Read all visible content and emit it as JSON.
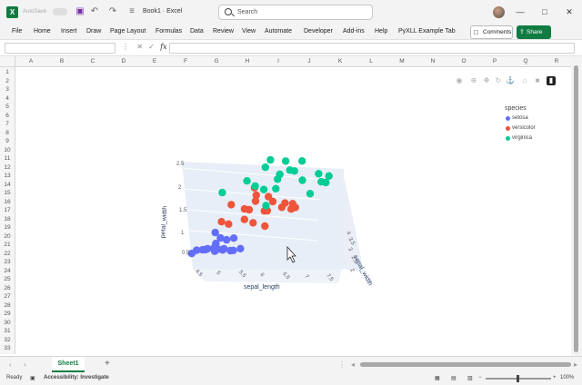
{
  "titlebar": {
    "autosave_label": "AutoSave",
    "doc_title": "Book1 · Excel",
    "search_placeholder": "Search"
  },
  "menu": [
    "File",
    "Home",
    "Insert",
    "Draw",
    "Page Layout",
    "Formulas",
    "Data",
    "Review",
    "View",
    "Automate",
    "Developer",
    "Add-ins",
    "Help",
    "PyXLL Example Tab"
  ],
  "comments_label": "Comments",
  "share_label": "Share",
  "formula_bar": {
    "fx_label": "fx"
  },
  "columns": [
    "A",
    "B",
    "C",
    "D",
    "E",
    "F",
    "G",
    "H",
    "I",
    "J",
    "K",
    "L",
    "M",
    "N",
    "O",
    "P",
    "Q",
    "R"
  ],
  "rows": [
    "1",
    "2",
    "3",
    "4",
    "5",
    "6",
    "7",
    "8",
    "9",
    "10",
    "11",
    "12",
    "13",
    "14",
    "15",
    "16",
    "17",
    "18",
    "19",
    "20",
    "21",
    "22",
    "23",
    "24",
    "25",
    "26",
    "27",
    "28",
    "29",
    "30",
    "31",
    "32",
    "33"
  ],
  "chart_data": {
    "type": "scatter",
    "dimensions": 3,
    "x_label": "sepal_length",
    "y_label": "sepal_width",
    "z_label": "petal_width",
    "x_ticks": [
      "4.5",
      "5",
      "5.5",
      "6",
      "6.5",
      "7",
      "7.5"
    ],
    "y_ticks": [
      "2",
      "2.5",
      "3",
      "3.5",
      "4"
    ],
    "z_ticks": [
      "0.5",
      "1",
      "1.5",
      "2",
      "2.5"
    ],
    "legend": {
      "title": "species",
      "position": "top-right",
      "items": [
        {
          "name": "setosa",
          "color": "#636efa"
        },
        {
          "name": "versicolor",
          "color": "#ef553b"
        },
        {
          "name": "virginica",
          "color": "#00cc96"
        }
      ]
    },
    "series": [
      {
        "name": "setosa",
        "points": [
          [
            4.3,
            3.0,
            0.1
          ],
          [
            4.4,
            2.9,
            0.2
          ],
          [
            4.6,
            3.1,
            0.2
          ],
          [
            4.7,
            3.2,
            0.2
          ],
          [
            4.8,
            3.4,
            0.2
          ],
          [
            4.9,
            3.0,
            0.2
          ],
          [
            5.0,
            3.6,
            0.2
          ],
          [
            5.0,
            3.4,
            0.2
          ],
          [
            5.1,
            3.5,
            0.2
          ],
          [
            5.1,
            3.8,
            0.3
          ],
          [
            5.2,
            3.4,
            0.2
          ],
          [
            5.3,
            3.7,
            0.2
          ],
          [
            5.4,
            3.9,
            0.4
          ],
          [
            5.4,
            3.4,
            0.2
          ],
          [
            5.5,
            3.5,
            0.2
          ],
          [
            5.7,
            4.4,
            0.4
          ],
          [
            5.8,
            4.0,
            0.2
          ],
          [
            4.5,
            2.3,
            0.3
          ],
          [
            5.0,
            3.5,
            0.6
          ],
          [
            5.1,
            3.3,
            0.5
          ]
        ]
      },
      {
        "name": "versicolor",
        "points": [
          [
            4.9,
            2.4,
            1.0
          ],
          [
            5.0,
            2.0,
            1.0
          ],
          [
            5.2,
            2.7,
            1.4
          ],
          [
            5.5,
            2.4,
            1.1
          ],
          [
            5.6,
            2.9,
            1.3
          ],
          [
            5.7,
            2.8,
            1.3
          ],
          [
            5.8,
            2.7,
            1.0
          ],
          [
            5.9,
            3.0,
            1.5
          ],
          [
            6.0,
            2.2,
            1.0
          ],
          [
            6.0,
            3.4,
            1.6
          ],
          [
            6.1,
            2.8,
            1.3
          ],
          [
            6.2,
            2.9,
            1.3
          ],
          [
            6.3,
            3.3,
            1.6
          ],
          [
            6.4,
            3.2,
            1.5
          ],
          [
            6.6,
            3.0,
            1.4
          ],
          [
            6.7,
            3.1,
            1.5
          ],
          [
            6.8,
            2.8,
            1.4
          ],
          [
            6.9,
            3.1,
            1.5
          ],
          [
            7.0,
            3.2,
            1.4
          ],
          [
            5.9,
            3.2,
            1.8
          ]
        ]
      },
      {
        "name": "virginica",
        "points": [
          [
            4.9,
            2.5,
            1.7
          ],
          [
            5.6,
            2.8,
            2.0
          ],
          [
            5.8,
            2.7,
            1.9
          ],
          [
            6.0,
            2.2,
            1.5
          ],
          [
            6.1,
            3.0,
            1.8
          ],
          [
            6.3,
            3.3,
            2.5
          ],
          [
            6.4,
            2.8,
            2.1
          ],
          [
            6.5,
            3.0,
            2.2
          ],
          [
            6.7,
            3.3,
            2.5
          ],
          [
            6.8,
            3.2,
            2.3
          ],
          [
            6.9,
            3.1,
            2.3
          ],
          [
            7.1,
            3.0,
            2.1
          ],
          [
            7.2,
            3.6,
            2.5
          ],
          [
            7.3,
            2.9,
            1.8
          ],
          [
            7.6,
            3.0,
            2.1
          ],
          [
            7.7,
            3.8,
            2.2
          ],
          [
            7.7,
            2.6,
            2.3
          ],
          [
            7.9,
            3.8,
            2.0
          ],
          [
            6.3,
            2.5,
            1.9
          ],
          [
            6.2,
            3.4,
            2.3
          ]
        ]
      }
    ]
  },
  "sheet_tab": "Sheet1",
  "status": {
    "ready": "Ready",
    "accessibility": "Accessibility: Investigate",
    "zoom": "100%"
  }
}
